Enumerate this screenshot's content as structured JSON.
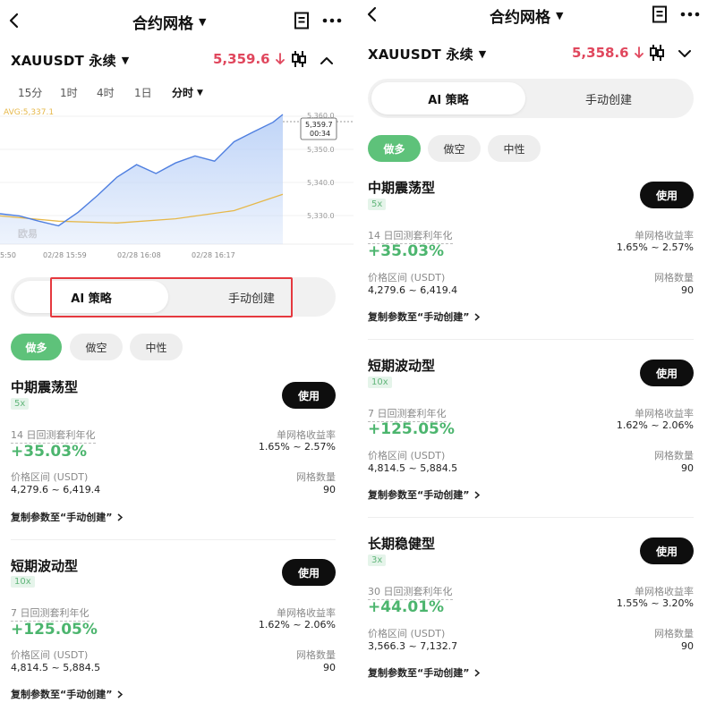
{
  "nav": {
    "title": "合约网格"
  },
  "left": {
    "symbol": "XAUUSDT 永续",
    "price": "5,359.6",
    "timeframes": [
      "15分",
      "1时",
      "4时",
      "1日",
      "分时"
    ],
    "chart": {
      "avg_label": "AVG:5,337.1",
      "price_tag": "5,359.7",
      "countdown": "00:34",
      "watermark": "欧易",
      "y_ticks": [
        "5,360.0",
        "5,350.0",
        "5,340.0",
        "5,330.0"
      ],
      "x_ticks": [
        "5:50",
        "02/28 15:59",
        "02/28 16:08",
        "02/28 16:17"
      ]
    }
  },
  "right": {
    "symbol": "XAUUSDT 永续",
    "price": "5,358.6"
  },
  "tabs": {
    "ai": "AI 策略",
    "manual": "手动创建"
  },
  "filters": [
    "做多",
    "做空",
    "中性"
  ],
  "labels": {
    "use": "使用",
    "per_grid": "单网格收益率",
    "range": "价格区间 (USDT)",
    "grid_count": "网格数量",
    "copy": "复制参数至“手动创建”"
  },
  "strategies": [
    {
      "title": "中期震荡型",
      "leverage": "5x",
      "backtest_label": "14 日回测套利年化",
      "apy": "+35.03%",
      "per_grid": "1.65% ~ 2.57%",
      "range": "4,279.6 ~ 6,419.4",
      "grids": "90"
    },
    {
      "title": "短期波动型",
      "leverage": "10x",
      "backtest_label": "7 日回测套利年化",
      "apy": "+125.05%",
      "per_grid": "1.62% ~ 2.06%",
      "range": "4,814.5 ~ 5,884.5",
      "grids": "90"
    },
    {
      "title": "长期稳健型",
      "leverage": "3x",
      "backtest_label": "30 日回测套利年化",
      "apy": "+44.01%",
      "per_grid": "1.55% ~ 3.20%",
      "range": "3,566.3 ~ 7,132.7",
      "grids": "90"
    }
  ],
  "chart_data": {
    "type": "area",
    "price_series": [
      [
        "15:51",
        5331.6
      ],
      [
        "15:53",
        5331.0
      ],
      [
        "15:55",
        5329.5
      ],
      [
        "15:57",
        5328.2
      ],
      [
        "15:59",
        5332.0
      ],
      [
        "16:01",
        5336.8
      ],
      [
        "16:03",
        5342.0
      ],
      [
        "16:05",
        5345.5
      ],
      [
        "16:07",
        5343.0
      ],
      [
        "16:09",
        5346.0
      ],
      [
        "16:11",
        5348.0
      ],
      [
        "16:13",
        5346.5
      ],
      [
        "16:15",
        5352.0
      ],
      [
        "16:17",
        5354.8
      ],
      [
        "16:19",
        5357.5
      ],
      [
        "16:20",
        5359.7
      ]
    ],
    "avg_series": [
      [
        "15:51",
        5331.0
      ],
      [
        "15:57",
        5329.5
      ],
      [
        "16:03",
        5329.0
      ],
      [
        "16:09",
        5330.2
      ],
      [
        "16:15",
        5332.5
      ],
      [
        "16:20",
        5337.1
      ]
    ],
    "ylim": [
      5323,
      5363
    ],
    "colors": {
      "line": "#4f7fe0",
      "fill": "#bcd2f7",
      "avg": "#e6b84a"
    }
  }
}
